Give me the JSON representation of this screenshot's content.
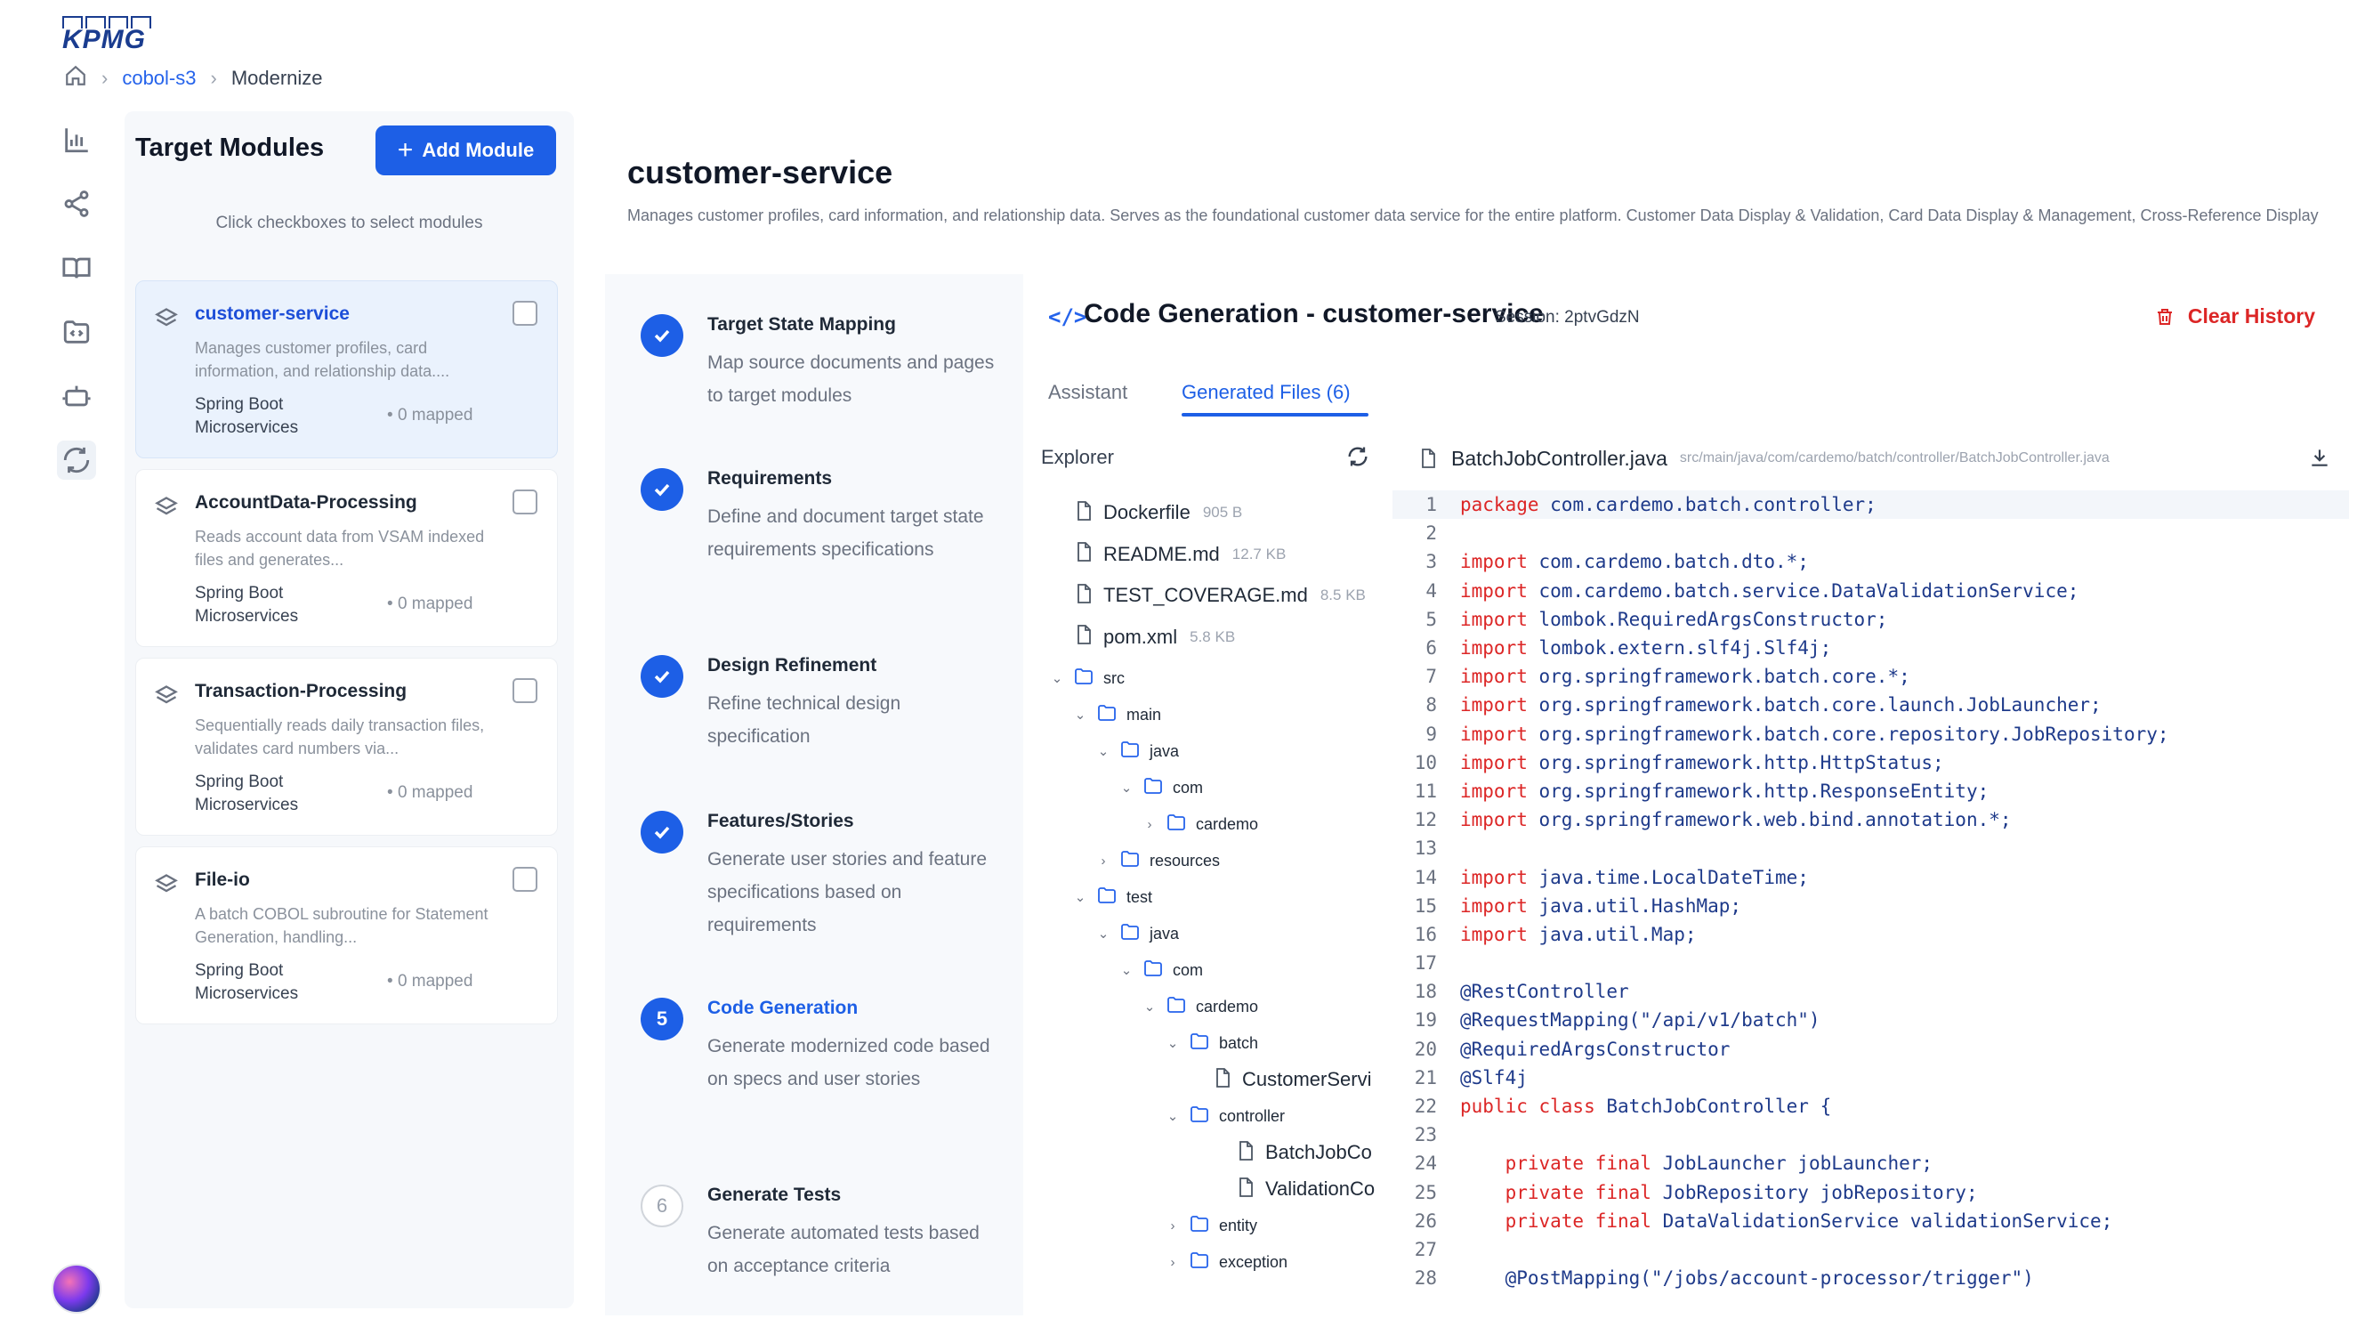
{
  "logo": {
    "text": "KPMG"
  },
  "breadcrumb": {
    "project": "cobol-s3",
    "current": "Modernize"
  },
  "rail": {
    "icons": [
      "bar-chart-icon",
      "share-icon",
      "book-icon",
      "folder-code-icon",
      "robot-icon",
      "refresh-cycle-icon"
    ]
  },
  "modules_panel": {
    "title": "Target Modules",
    "add_button": "Add Module",
    "hint": "Click checkboxes to select modules",
    "modules": [
      {
        "name": "customer-service",
        "description": "Manages customer profiles, card information, and relationship data....",
        "tech_line1": "Spring Boot",
        "tech_line2": "Microservices",
        "mapped": "0 mapped",
        "selected": true
      },
      {
        "name": "AccountData-Processing",
        "description": "Reads account data from VSAM indexed files and generates...",
        "tech_line1": "Spring Boot",
        "tech_line2": "Microservices",
        "mapped": "0 mapped",
        "selected": false
      },
      {
        "name": "Transaction-Processing",
        "description": "Sequentially reads daily transaction files, validates card numbers via...",
        "tech_line1": "Spring Boot",
        "tech_line2": "Microservices",
        "mapped": "0 mapped",
        "selected": false
      },
      {
        "name": "File-io",
        "description": "A batch COBOL subroutine for Statement Generation, handling...",
        "tech_line1": "Spring Boot",
        "tech_line2": "Microservices",
        "mapped": "0 mapped",
        "selected": false
      }
    ]
  },
  "service": {
    "title": "customer-service",
    "description": "Manages customer profiles, card information, and relationship data. Serves as the foundational customer data service for the entire platform. Customer Data Display & Validation, Card Data Display & Management, Cross-Reference Display"
  },
  "steps": [
    {
      "name": "Target State Mapping",
      "description": "Map source documents and pages to target modules",
      "state": "done"
    },
    {
      "name": "Requirements",
      "description": "Define and document target state requirements specifications",
      "state": "done"
    },
    {
      "name": "Design Refinement",
      "description": "Refine technical design specification",
      "state": "done"
    },
    {
      "name": "Features/Stories",
      "description": "Generate user stories and feature specifications based on requirements",
      "state": "done"
    },
    {
      "name": "Code Generation",
      "number": "5",
      "description": "Generate modernized code based on specs and user stories",
      "state": "current"
    },
    {
      "name": "Generate Tests",
      "number": "6",
      "description": "Generate automated tests based on acceptance criteria",
      "state": "pending"
    }
  ],
  "code_gen": {
    "icon": "</>",
    "title": "Code Generation - customer-service",
    "session": "Session: 2ptvGdzN",
    "clear_label": "Clear History",
    "tabs": [
      "Assistant",
      "Generated Files (6)"
    ],
    "active_tab": 1
  },
  "explorer": {
    "title": "Explorer",
    "tree": [
      {
        "name": "Dockerfile",
        "size": "905 B",
        "type": "file",
        "depth": 0
      },
      {
        "name": "README.md",
        "size": "12.7 KB",
        "type": "file",
        "depth": 0
      },
      {
        "name": "TEST_COVERAGE.md",
        "size": "8.5 KB",
        "type": "file",
        "depth": 0
      },
      {
        "name": "pom.xml",
        "size": "5.8 KB",
        "type": "file",
        "depth": 0
      },
      {
        "name": "src",
        "type": "dir",
        "open": true,
        "depth": 0
      },
      {
        "name": "main",
        "type": "dir",
        "open": true,
        "depth": 1
      },
      {
        "name": "java",
        "type": "dir",
        "open": true,
        "depth": 2
      },
      {
        "name": "com",
        "type": "dir",
        "open": true,
        "depth": 3
      },
      {
        "name": "cardemo",
        "type": "dir",
        "open": false,
        "depth": 4
      },
      {
        "name": "resources",
        "type": "dir",
        "open": false,
        "depth": 2
      },
      {
        "name": "test",
        "type": "dir",
        "open": true,
        "depth": 1
      },
      {
        "name": "java",
        "type": "dir",
        "open": true,
        "depth": 2
      },
      {
        "name": "com",
        "type": "dir",
        "open": true,
        "depth": 3
      },
      {
        "name": "cardemo",
        "type": "dir",
        "open": true,
        "depth": 4
      },
      {
        "name": "batch",
        "type": "dir",
        "open": true,
        "depth": 5
      },
      {
        "name": "CustomerServi",
        "type": "file",
        "depth": 6
      },
      {
        "name": "controller",
        "type": "dir",
        "open": true,
        "depth": 5
      },
      {
        "name": "BatchJobCo",
        "type": "file",
        "depth": 7
      },
      {
        "name": "ValidationCo",
        "type": "file",
        "depth": 7
      },
      {
        "name": "entity",
        "type": "dir",
        "open": false,
        "depth": 5
      },
      {
        "name": "exception",
        "type": "dir",
        "open": false,
        "depth": 5
      }
    ]
  },
  "editor": {
    "file_name": "BatchJobController.java",
    "file_path": "src/main/java/com/cardemo/batch/controller/BatchJobController.java",
    "lines": [
      {
        "n": "1",
        "kw": "package",
        "rest": " com.cardemo.batch.controller;"
      },
      {
        "n": "2",
        "kw": "",
        "rest": ""
      },
      {
        "n": "3",
        "kw": "import",
        "rest": " com.cardemo.batch.dto.*;"
      },
      {
        "n": "4",
        "kw": "import",
        "rest": " com.cardemo.batch.service.DataValidationService;"
      },
      {
        "n": "5",
        "kw": "import",
        "rest": " lombok.RequiredArgsConstructor;"
      },
      {
        "n": "6",
        "kw": "import",
        "rest": " lombok.extern.slf4j.Slf4j;"
      },
      {
        "n": "7",
        "kw": "import",
        "rest": " org.springframework.batch.core.*;"
      },
      {
        "n": "8",
        "kw": "import",
        "rest": " org.springframework.batch.core.launch.JobLauncher;"
      },
      {
        "n": "9",
        "kw": "import",
        "rest": " org.springframework.batch.core.repository.JobRepository;"
      },
      {
        "n": "10",
        "kw": "import",
        "rest": " org.springframework.http.HttpStatus;"
      },
      {
        "n": "11",
        "kw": "import",
        "rest": " org.springframework.http.ResponseEntity;"
      },
      {
        "n": "12",
        "kw": "import",
        "rest": " org.springframework.web.bind.annotation.*;"
      },
      {
        "n": "13",
        "kw": "",
        "rest": ""
      },
      {
        "n": "14",
        "kw": "import",
        "rest": " java.time.LocalDateTime;"
      },
      {
        "n": "15",
        "kw": "import",
        "rest": " java.util.HashMap;"
      },
      {
        "n": "16",
        "kw": "import",
        "rest": " java.util.Map;"
      },
      {
        "n": "17",
        "kw": "",
        "rest": ""
      },
      {
        "n": "18",
        "kw": "",
        "rest": "@RestController"
      },
      {
        "n": "19",
        "kw": "",
        "rest": "@RequestMapping(\"/api/v1/batch\")"
      },
      {
        "n": "20",
        "kw": "",
        "rest": "@RequiredArgsConstructor"
      },
      {
        "n": "21",
        "kw": "",
        "rest": "@Slf4j"
      },
      {
        "n": "22",
        "kw": "public class",
        "rest": " BatchJobController {"
      },
      {
        "n": "23",
        "kw": "",
        "rest": ""
      },
      {
        "n": "24",
        "kw": "    private final",
        "rest": " JobLauncher jobLauncher;"
      },
      {
        "n": "25",
        "kw": "    private final",
        "rest": " JobRepository jobRepository;"
      },
      {
        "n": "26",
        "kw": "    private final",
        "rest": " DataValidationService validationService;"
      },
      {
        "n": "27",
        "kw": "",
        "rest": ""
      },
      {
        "n": "28",
        "kw": "",
        "rest": "    @PostMapping(\"/jobs/account-processor/trigger\")"
      }
    ]
  },
  "colors": {
    "accent": "#1d5fe6",
    "danger": "#dc2626",
    "keyword": "#dc2626",
    "code_text": "#1e3a8a"
  }
}
